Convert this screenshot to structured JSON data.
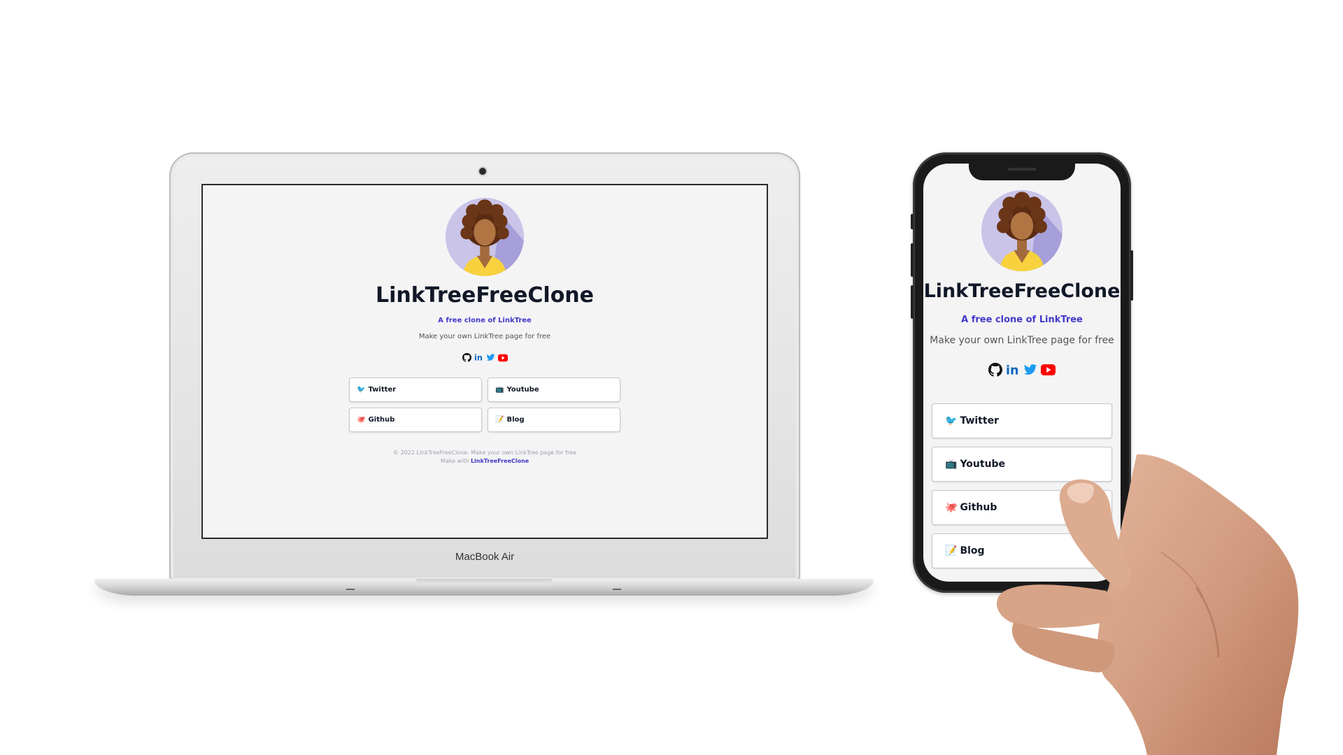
{
  "laptop": {
    "brand": "MacBook Air",
    "page": {
      "title": "LinkTreeFreeClone",
      "subtitle": "A free clone of LinkTree",
      "description": "Make your own LinkTree page for free",
      "socials": [
        "github-icon",
        "linkedin-icon",
        "twitter-icon",
        "youtube-icon"
      ],
      "links": [
        {
          "emoji": "🐦",
          "label": "Twitter"
        },
        {
          "emoji": "📺",
          "label": "Youtube"
        },
        {
          "emoji": "🐙",
          "label": "Github"
        },
        {
          "emoji": "📝",
          "label": "Blog"
        }
      ],
      "footer": {
        "copyright": "© 2022 LinkTreeFreeClone. Make your own LinkTree page for free",
        "made_with_prefix": "Make with",
        "made_with_link": "LinkTreeFreeClone"
      }
    }
  },
  "phone": {
    "page": {
      "title": "LinkTreeFreeClone",
      "subtitle": "A free clone of LinkTree",
      "description": "Make your own LinkTree page for free",
      "socials": [
        "github-icon",
        "linkedin-icon",
        "twitter-icon",
        "youtube-icon"
      ],
      "links": [
        {
          "emoji": "🐦",
          "label": "Twitter"
        },
        {
          "emoji": "📺",
          "label": "Youtube"
        },
        {
          "emoji": "🐙",
          "label": "Github"
        },
        {
          "emoji": "📝",
          "label": "Blog"
        }
      ]
    }
  },
  "colors": {
    "accent": "#4338ca",
    "twitter": "#1d9bf0",
    "linkedin": "#0a66c2",
    "youtube": "#ff0000",
    "page_bg": "#f4f4f5"
  }
}
